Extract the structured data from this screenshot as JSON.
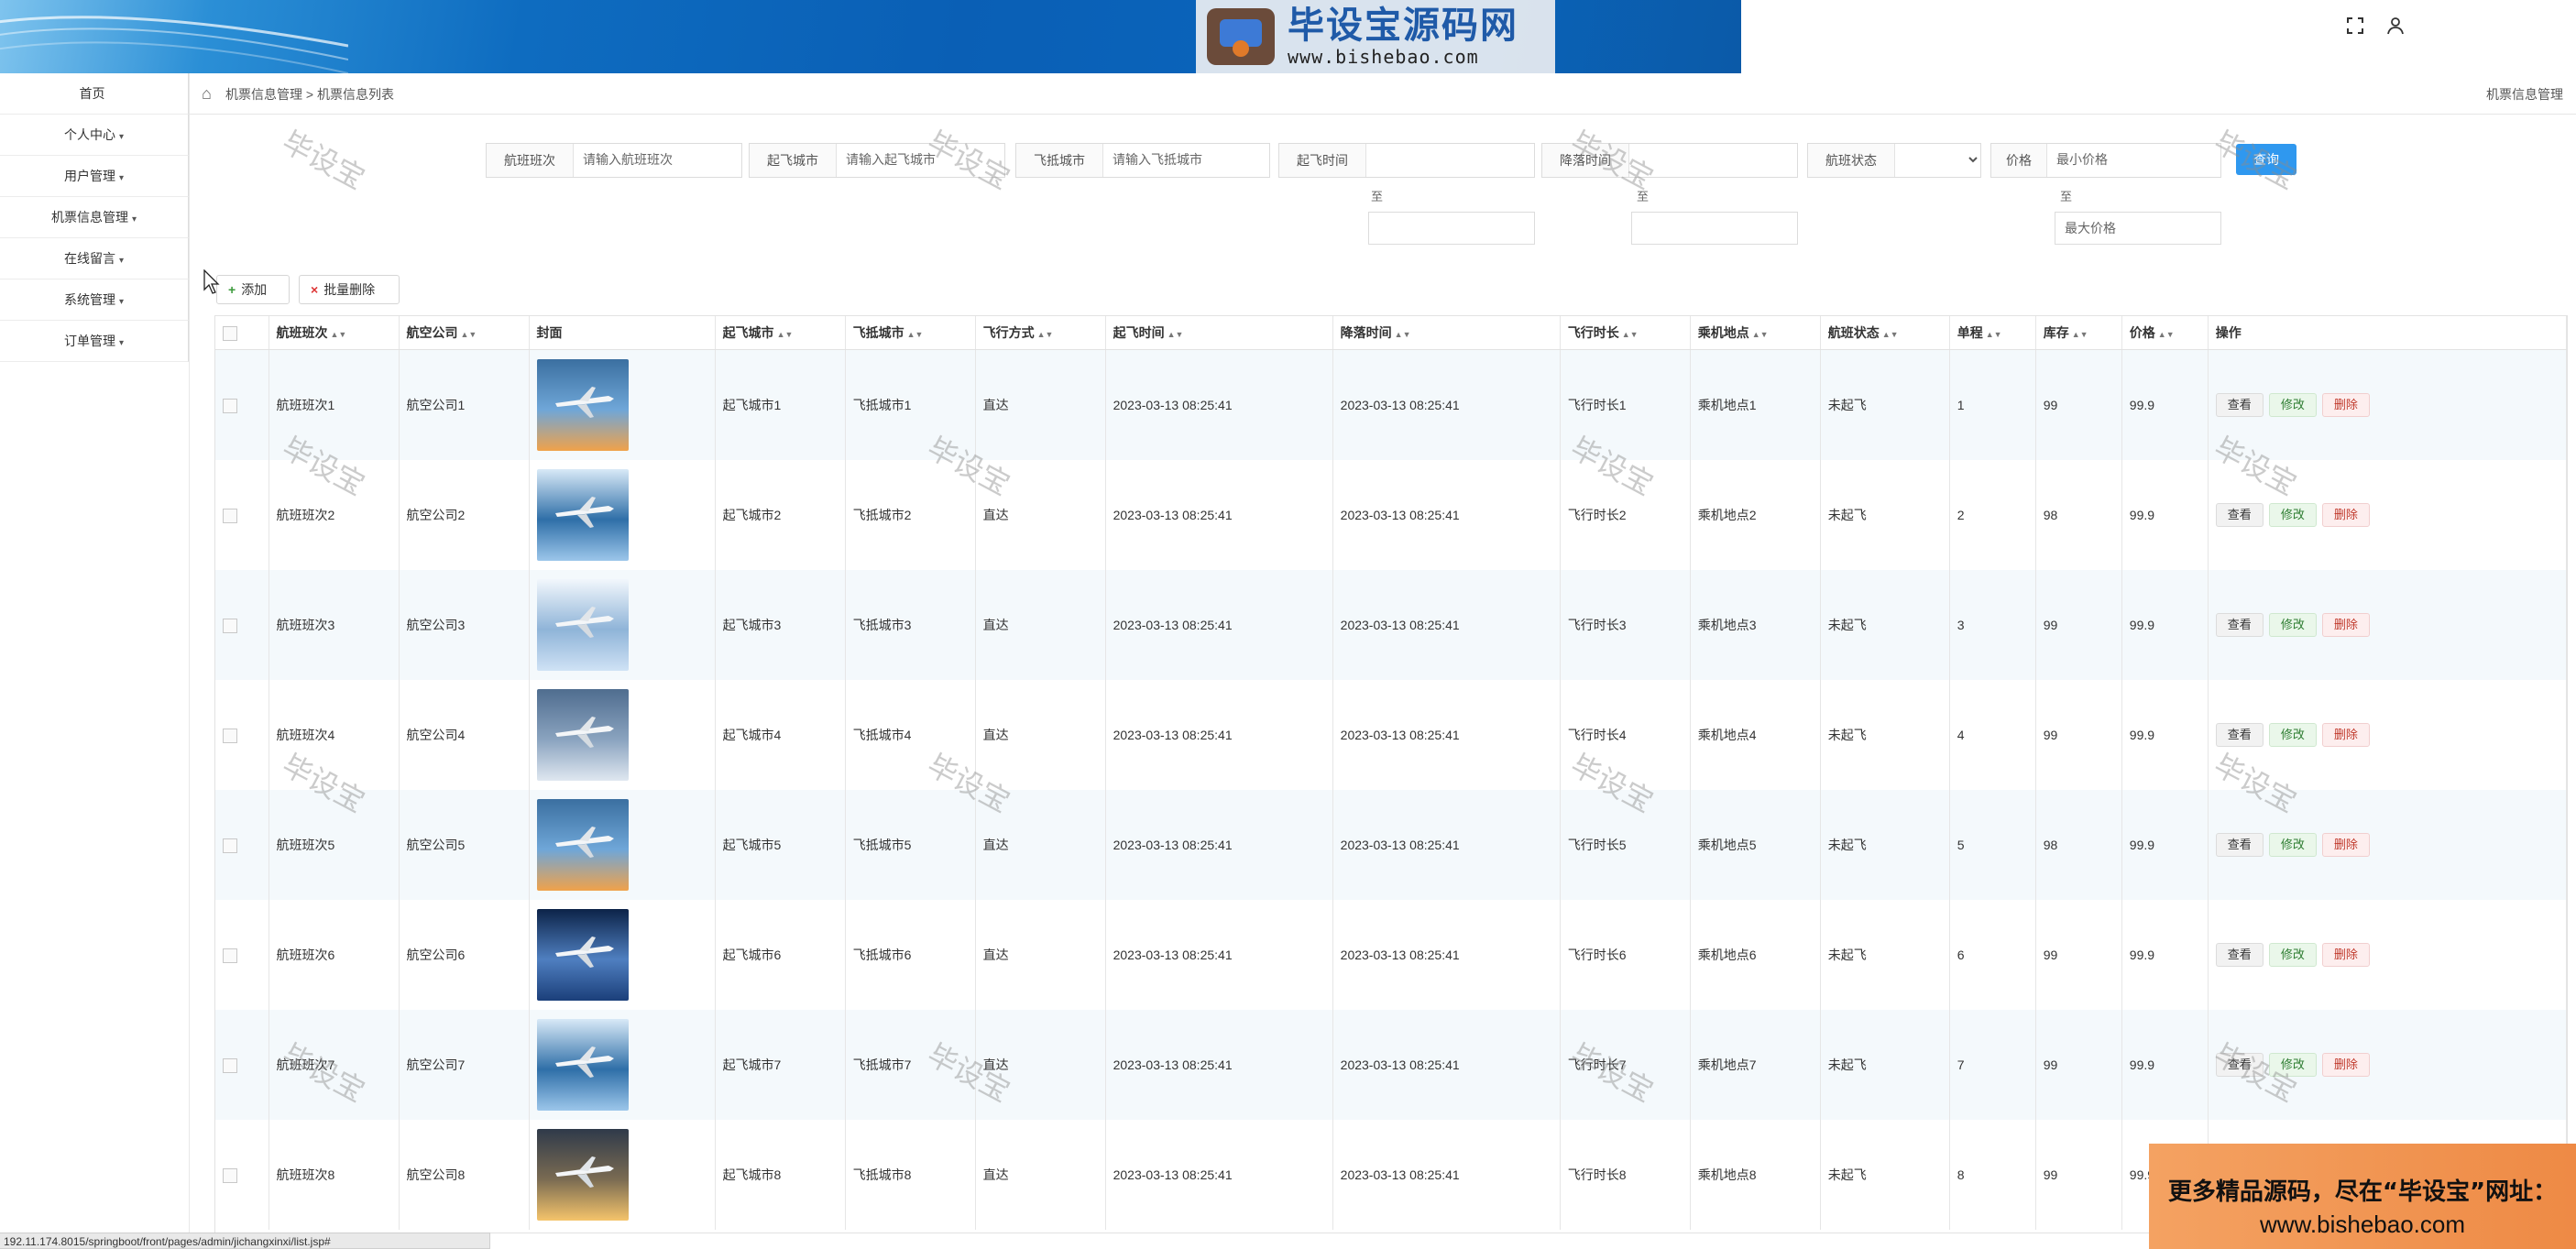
{
  "brand": {
    "logo_title": "毕设宝源码网",
    "logo_url": "www.bishebao.com",
    "accent": "#0a5fb5"
  },
  "header": {
    "fullscreen_icon": "expand-icon",
    "user_icon": "user-icon"
  },
  "sidebar": {
    "items": [
      {
        "label": "首页",
        "caret": ""
      },
      {
        "label": "个人中心",
        "caret": "▾"
      },
      {
        "label": "用户管理",
        "caret": "▾"
      },
      {
        "label": "机票信息管理",
        "caret": "▾"
      },
      {
        "label": "在线留言",
        "caret": "▾"
      },
      {
        "label": "系统管理",
        "caret": "▾"
      },
      {
        "label": "订单管理",
        "caret": "▾"
      }
    ]
  },
  "breadcrumb": {
    "path": "机票信息管理 > 机票信息列表",
    "right": "机票信息管理"
  },
  "search": {
    "flight_no": {
      "label": "航班班次",
      "placeholder": "请输入航班班次"
    },
    "depart_city": {
      "label": "起飞城市",
      "placeholder": "请输入起飞城市"
    },
    "arrive_city": {
      "label": "飞抵城市",
      "placeholder": "请输入飞抵城市"
    },
    "depart_time": {
      "label": "起飞时间",
      "to": "至"
    },
    "land_time": {
      "label": "降落时间",
      "to": "至"
    },
    "status": {
      "label": "航班状态",
      "value": ""
    },
    "price": {
      "label": "价格",
      "min_placeholder": "最小价格",
      "to": "至",
      "max_placeholder": "最大价格"
    },
    "button": "查询"
  },
  "toolbar": {
    "add": "添加",
    "batch_delete": "批量删除"
  },
  "table": {
    "headers": [
      "航班班次",
      "航空公司",
      "封面",
      "起飞城市",
      "飞抵城市",
      "飞行方式",
      "起飞时间",
      "降落时间",
      "飞行时长",
      "乘机地点",
      "航班状态",
      "单程",
      "库存",
      "价格",
      "操作"
    ],
    "actions": {
      "view": "查看",
      "edit": "修改",
      "delete": "删除"
    },
    "rows": [
      {
        "flight_no": "航班班次1",
        "airline": "航空公司1",
        "from": "起飞城市1",
        "to": "飞抵城市1",
        "mode": "直达",
        "depart": "2023-03-13 08:25:41",
        "land": "2023-03-13 08:25:41",
        "duration": "飞行时长1",
        "gate": "乘机地点1",
        "status": "未起飞",
        "single": "1",
        "stock": "99",
        "price": "99.9"
      },
      {
        "flight_no": "航班班次2",
        "airline": "航空公司2",
        "from": "起飞城市2",
        "to": "飞抵城市2",
        "mode": "直达",
        "depart": "2023-03-13 08:25:41",
        "land": "2023-03-13 08:25:41",
        "duration": "飞行时长2",
        "gate": "乘机地点2",
        "status": "未起飞",
        "single": "2",
        "stock": "98",
        "price": "99.9"
      },
      {
        "flight_no": "航班班次3",
        "airline": "航空公司3",
        "from": "起飞城市3",
        "to": "飞抵城市3",
        "mode": "直达",
        "depart": "2023-03-13 08:25:41",
        "land": "2023-03-13 08:25:41",
        "duration": "飞行时长3",
        "gate": "乘机地点3",
        "status": "未起飞",
        "single": "3",
        "stock": "99",
        "price": "99.9"
      },
      {
        "flight_no": "航班班次4",
        "airline": "航空公司4",
        "from": "起飞城市4",
        "to": "飞抵城市4",
        "mode": "直达",
        "depart": "2023-03-13 08:25:41",
        "land": "2023-03-13 08:25:41",
        "duration": "飞行时长4",
        "gate": "乘机地点4",
        "status": "未起飞",
        "single": "4",
        "stock": "99",
        "price": "99.9"
      },
      {
        "flight_no": "航班班次5",
        "airline": "航空公司5",
        "from": "起飞城市5",
        "to": "飞抵城市5",
        "mode": "直达",
        "depart": "2023-03-13 08:25:41",
        "land": "2023-03-13 08:25:41",
        "duration": "飞行时长5",
        "gate": "乘机地点5",
        "status": "未起飞",
        "single": "5",
        "stock": "98",
        "price": "99.9"
      },
      {
        "flight_no": "航班班次6",
        "airline": "航空公司6",
        "from": "起飞城市6",
        "to": "飞抵城市6",
        "mode": "直达",
        "depart": "2023-03-13 08:25:41",
        "land": "2023-03-13 08:25:41",
        "duration": "飞行时长6",
        "gate": "乘机地点6",
        "status": "未起飞",
        "single": "6",
        "stock": "99",
        "price": "99.9"
      },
      {
        "flight_no": "航班班次7",
        "airline": "航空公司7",
        "from": "起飞城市7",
        "to": "飞抵城市7",
        "mode": "直达",
        "depart": "2023-03-13 08:25:41",
        "land": "2023-03-13 08:25:41",
        "duration": "飞行时长7",
        "gate": "乘机地点7",
        "status": "未起飞",
        "single": "7",
        "stock": "99",
        "price": "99.9"
      },
      {
        "flight_no": "航班班次8",
        "airline": "航空公司8",
        "from": "起飞城市8",
        "to": "飞抵城市8",
        "mode": "直达",
        "depart": "2023-03-13 08:25:41",
        "land": "2023-03-13 08:25:41",
        "duration": "飞行时长8",
        "gate": "乘机地点8",
        "status": "未起飞",
        "single": "8",
        "stock": "99",
        "price": "99.9"
      }
    ]
  },
  "watermark": "毕设宝",
  "ad": {
    "line1": "更多精品源码，尽在“毕设宝”网址：",
    "line2": "www.bishebao.com"
  },
  "statusbar": "192.11.174.8015/springboot/front/pages/admin/jichangxinxi/list.jsp#"
}
